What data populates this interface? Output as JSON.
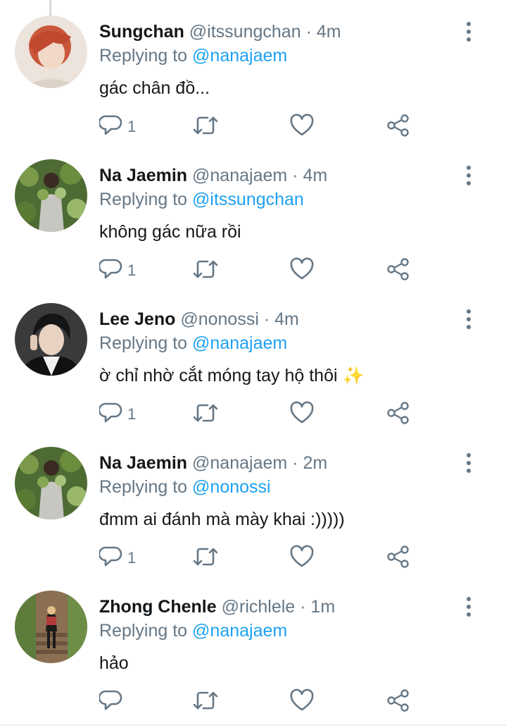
{
  "tweets": [
    {
      "name": "Sungchan",
      "handle": "@itssungchan",
      "separator": "·",
      "time": "4m",
      "replying_prefix": "Replying to ",
      "replying_to": "@nanajaem",
      "text": "gác chân đồ...",
      "reply_count": "1"
    },
    {
      "name": "Na Jaemin",
      "handle": "@nanajaem",
      "separator": "·",
      "time": "4m",
      "replying_prefix": "Replying to ",
      "replying_to": "@itssungchan",
      "text": "không gác nữa rồi",
      "reply_count": "1"
    },
    {
      "name": "Lee Jeno",
      "handle": "@nonossi",
      "separator": "·",
      "time": "4m",
      "replying_prefix": "Replying to ",
      "replying_to": "@nanajaem",
      "text": "ờ chỉ nhờ cắt móng tay hộ thôi",
      "emoji": "✨",
      "reply_count": "1"
    },
    {
      "name": "Na Jaemin",
      "handle": "@nanajaem",
      "separator": "·",
      "time": "2m",
      "replying_prefix": "Replying to ",
      "replying_to": "@nonossi",
      "text": "đmm ai đánh mà mày khai :)))))",
      "reply_count": "1"
    },
    {
      "name": "Zhong Chenle",
      "handle": "@richlele",
      "separator": "·",
      "time": "1m",
      "replying_prefix": "Replying to ",
      "replying_to": "@nanajaem",
      "text": "hảo",
      "reply_count": ""
    }
  ],
  "icons": {
    "reply": "reply-icon",
    "retweet": "retweet-icon",
    "like": "heart-icon",
    "share": "share-icon",
    "more": "more-vertical-icon"
  },
  "colors": {
    "text": "#14171a",
    "secondary": "#657786",
    "accent": "#1da1f2",
    "thread_line": "#d6d9db"
  }
}
